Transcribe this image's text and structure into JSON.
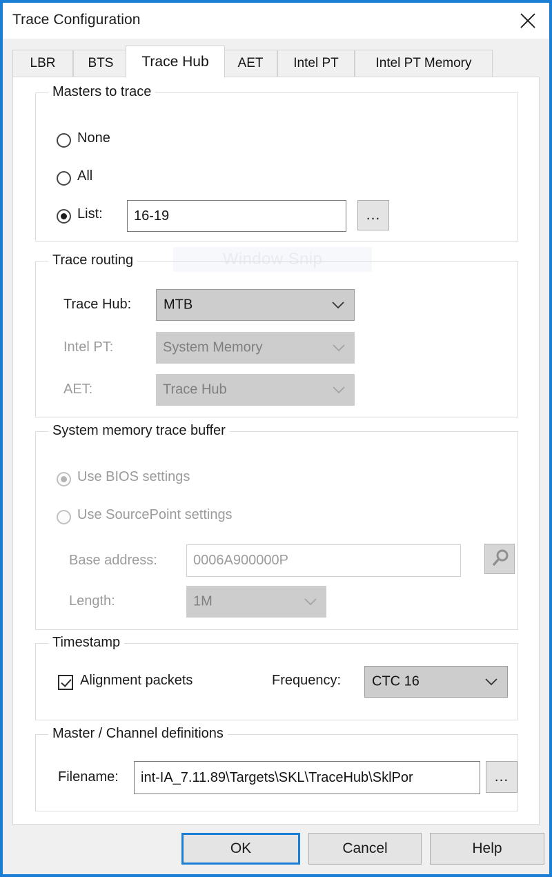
{
  "window": {
    "title": "Trace Configuration",
    "close_icon": "close-icon",
    "accent_color": "#1a7fd4"
  },
  "tabs": [
    {
      "label": "LBR",
      "active": false
    },
    {
      "label": "BTS",
      "active": false
    },
    {
      "label": "Trace Hub",
      "active": true
    },
    {
      "label": "AET",
      "active": false
    },
    {
      "label": "Intel PT",
      "active": false
    },
    {
      "label": "Intel PT Memory",
      "active": false
    }
  ],
  "overlay": {
    "watermark": "Window Snip"
  },
  "masters_group": {
    "title": "Masters to trace",
    "options": [
      {
        "label": "None",
        "checked": false
      },
      {
        "label": "All",
        "checked": false
      },
      {
        "label": "List:",
        "checked": true
      }
    ],
    "list_value": "16-19",
    "browse_label": "...",
    "browse_icon": "ellipsis-icon"
  },
  "routing_group": {
    "title": "Trace routing",
    "rows": [
      {
        "label": "Trace Hub:",
        "value": "MTB",
        "disabled": false
      },
      {
        "label": "Intel PT:",
        "value": "System Memory",
        "disabled": true
      },
      {
        "label": "AET:",
        "value": "Trace Hub",
        "disabled": true
      }
    ]
  },
  "buffer_group": {
    "title": "System memory trace buffer",
    "options": [
      {
        "label": "Use BIOS settings",
        "checked": true
      },
      {
        "label": "Use SourcePoint settings",
        "checked": false
      }
    ],
    "base_address_label": "Base address:",
    "base_address_value": "0006A900000P",
    "base_address_button_icon": "magnifier-icon",
    "length_label": "Length:",
    "length_value": "1M"
  },
  "timestamp_group": {
    "title": "Timestamp",
    "alignment_label": "Alignment packets",
    "alignment_checked": true,
    "frequency_label": "Frequency:",
    "frequency_value": "CTC 16"
  },
  "definitions_group": {
    "title": "Master / Channel definitions",
    "filename_label": "Filename:",
    "filename_value": "int-IA_7.11.89\\Targets\\SKL\\TraceHub\\SklPor",
    "browse_label": "...",
    "browse_icon": "ellipsis-icon"
  },
  "footer": {
    "ok_label": "OK",
    "cancel_label": "Cancel",
    "help_label": "Help"
  }
}
